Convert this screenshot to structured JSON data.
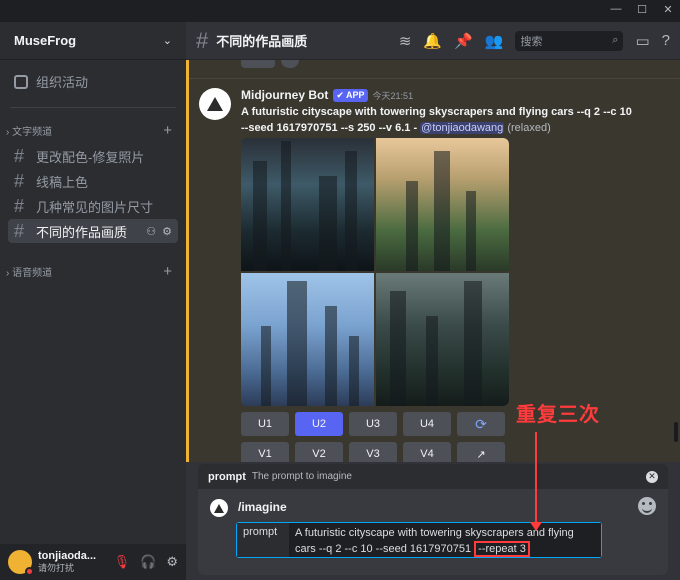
{
  "window": {
    "minimize_icon": "minimize-icon",
    "maximize_icon": "maximize-icon",
    "close_icon": "close-icon"
  },
  "sidebar": {
    "server_name": "MuseFrog",
    "events_label": "组织活动",
    "text_category": "文字频道",
    "voice_category": "语音频道",
    "channels": [
      {
        "label": "更改配色-修复照片"
      },
      {
        "label": "线稿上色"
      },
      {
        "label": "几种常见的图片尺寸"
      },
      {
        "label": "不同的作品画质"
      }
    ]
  },
  "user": {
    "name": "tonjiaoda...",
    "status": "请勿打扰"
  },
  "header": {
    "channel_title": "不同的作品画质",
    "search_placeholder": "搜索"
  },
  "message": {
    "author": "Midjourney Bot",
    "badge": "✔ APP",
    "timestamp": "今天21:51",
    "text": "A futuristic cityscape with towering skyscrapers and flying cars --q 2 --c 10 --seed 1617970751 --s 250 --v 6.1 - ",
    "mention": "@tonjiaodawang",
    "mode": "(relaxed)",
    "buttons_row1": [
      "U1",
      "U2",
      "U3",
      "U4"
    ],
    "buttons_row2": [
      "V1",
      "V2",
      "V3",
      "V4"
    ],
    "selected_button": "U2",
    "colors": {
      "accent": "#5865f2",
      "highlight_border": "#f0b232"
    }
  },
  "annotation": {
    "text": "重复三次",
    "color": "#ff3b3b"
  },
  "composer": {
    "option_name": "prompt",
    "option_desc": "The prompt to imagine",
    "command": "/imagine",
    "param_name": "prompt",
    "param_value_main": "A futuristic cityscape with towering skyscrapers and flying cars --q 2 --c 10 --seed 1617970751 ",
    "param_value_highlight": "--repeat 3"
  }
}
